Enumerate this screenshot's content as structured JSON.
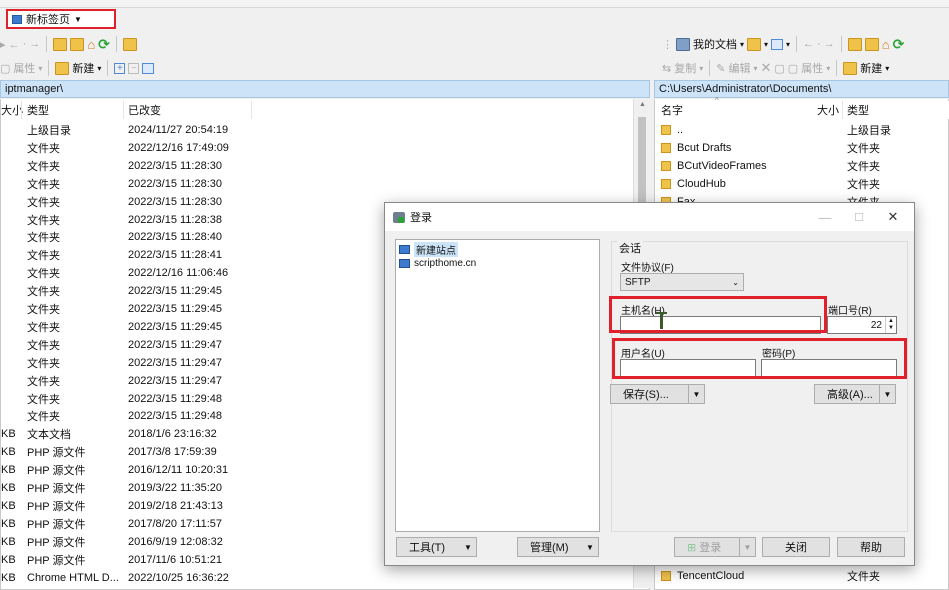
{
  "tab": {
    "label": "新标签页"
  },
  "left": {
    "path": "iptmanager\\",
    "headers": {
      "size": "大小",
      "type": "类型",
      "modified": "已改变"
    },
    "toolbar": {
      "properties": "属性",
      "new": "新建"
    },
    "rows": [
      {
        "size": "",
        "type": "上级目录",
        "modified": "2024/11/27 20:54:19"
      },
      {
        "size": "",
        "type": "文件夹",
        "modified": "2022/12/16 17:49:09"
      },
      {
        "size": "",
        "type": "文件夹",
        "modified": "2022/3/15 11:28:30"
      },
      {
        "size": "",
        "type": "文件夹",
        "modified": "2022/3/15 11:28:30"
      },
      {
        "size": "",
        "type": "文件夹",
        "modified": "2022/3/15 11:28:30"
      },
      {
        "size": "",
        "type": "文件夹",
        "modified": "2022/3/15 11:28:38"
      },
      {
        "size": "",
        "type": "文件夹",
        "modified": "2022/3/15 11:28:40"
      },
      {
        "size": "",
        "type": "文件夹",
        "modified": "2022/3/15 11:28:41"
      },
      {
        "size": "",
        "type": "文件夹",
        "modified": "2022/12/16 11:06:46"
      },
      {
        "size": "",
        "type": "文件夹",
        "modified": "2022/3/15 11:29:45"
      },
      {
        "size": "",
        "type": "文件夹",
        "modified": "2022/3/15 11:29:45"
      },
      {
        "size": "",
        "type": "文件夹",
        "modified": "2022/3/15 11:29:45"
      },
      {
        "size": "",
        "type": "文件夹",
        "modified": "2022/3/15 11:29:47"
      },
      {
        "size": "",
        "type": "文件夹",
        "modified": "2022/3/15 11:29:47"
      },
      {
        "size": "",
        "type": "文件夹",
        "modified": "2022/3/15 11:29:47"
      },
      {
        "size": "",
        "type": "文件夹",
        "modified": "2022/3/15 11:29:48"
      },
      {
        "size": "",
        "type": "文件夹",
        "modified": "2022/3/15 11:29:48"
      },
      {
        "size": "KB",
        "type": "文本文档",
        "modified": "2018/1/6 23:16:32"
      },
      {
        "size": "KB",
        "type": "PHP 源文件",
        "modified": "2017/3/8 17:59:39"
      },
      {
        "size": "KB",
        "type": "PHP 源文件",
        "modified": "2016/12/11 10:20:31"
      },
      {
        "size": "KB",
        "type": "PHP 源文件",
        "modified": "2019/3/22 11:35:20"
      },
      {
        "size": "KB",
        "type": "PHP 源文件",
        "modified": "2019/2/18 21:43:13"
      },
      {
        "size": "KB",
        "type": "PHP 源文件",
        "modified": "2017/8/20 17:11:57"
      },
      {
        "size": "KB",
        "type": "PHP 源文件",
        "modified": "2016/9/19 12:08:32"
      },
      {
        "size": "KB",
        "type": "PHP 源文件",
        "modified": "2017/11/6 10:51:21"
      },
      {
        "size": "KB",
        "type": "Chrome HTML D...",
        "modified": "2022/10/25 16:36:22"
      }
    ]
  },
  "right": {
    "location_label": "我的文档",
    "path": "C:\\Users\\Administrator\\Documents\\",
    "headers": {
      "name": "名字",
      "size": "大小",
      "type": "类型"
    },
    "toolbar": {
      "copy": "复制",
      "edit": "编辑",
      "properties": "属性",
      "new": "新建"
    },
    "rows": [
      {
        "name": "..",
        "type": "上级目录"
      },
      {
        "name": "Bcut Drafts",
        "type": "文件夹"
      },
      {
        "name": "BCutVideoFrames",
        "type": "文件夹"
      },
      {
        "name": "CloudHub",
        "type": "文件夹"
      },
      {
        "name": "Fax",
        "type": "文件夹"
      }
    ],
    "bottom_row": {
      "name": "TencentCloud",
      "type": "文件夹"
    }
  },
  "dialog": {
    "title": "登录",
    "sites": [
      {
        "label": "新建站点"
      },
      {
        "label": "scripthome.cn"
      }
    ],
    "session_group": "会话",
    "protocol_label": "文件协议(F)",
    "protocol_value": "SFTP",
    "host_label": "主机名(H)",
    "host_value": "",
    "port_label": "端口号(R)",
    "port_value": "22",
    "user_label": "用户名(U)",
    "user_value": "",
    "password_label": "密码(P)",
    "password_value": "",
    "save_btn": "保存(S)...",
    "advanced_btn": "高级(A)...",
    "tools_btn": "工具(T)",
    "manage_btn": "管理(M)",
    "login_btn": "登录",
    "close_btn": "关闭",
    "help_btn": "帮助",
    "minimize": "—",
    "maximize": "☐",
    "close_x": "✕"
  },
  "colors": {
    "highlight": "#e0202a",
    "path_bg": "#cde3f7",
    "folder": "#f1c24a"
  }
}
